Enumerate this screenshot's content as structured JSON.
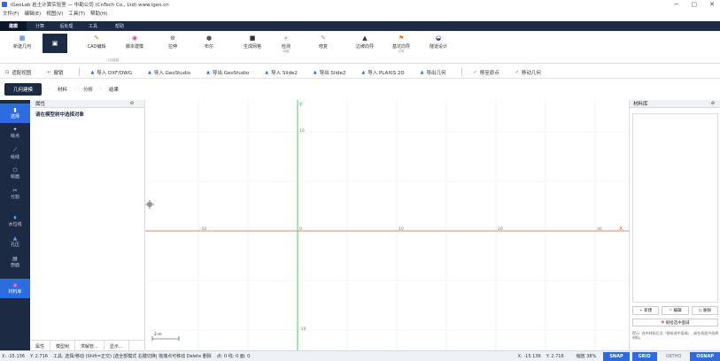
{
  "app": {
    "title": "iGeoLab 岩土计算实验室 — 中勘公司 (CnTech Co., Ltd)   www.igeo.cn"
  },
  "window_controls": {
    "minimize": "−",
    "maximize": "▢",
    "close": "✕"
  },
  "menu": [
    "文件(F)",
    "编辑(E)",
    "视图(V)",
    "工具(T)",
    "帮助(H)"
  ],
  "ribbon_tabs": [
    "建模",
    "计算",
    "后处理",
    "工具",
    "帮助"
  ],
  "ribbon": {
    "new_geometry": "新建几何",
    "cad_edit": "CAD编辑",
    "script_model": "脚本建模",
    "group_geometry": "几何建模",
    "extrude": "拉伸",
    "boolean": "布尔",
    "gen_mesh": "生成网格",
    "check": "检测",
    "group_mesh": "网格",
    "repair": "修复",
    "boundary_wizard": "边坡向导",
    "base_wizard": "基坑向导",
    "group_wizard": "向导",
    "tunnel_design": "隧道设计"
  },
  "toolbar2": {
    "fit_view": "适配视图",
    "undo": "撤销",
    "import_dxf": "导入 DXF/DWG",
    "import_geostudio": "导入 GeoStudio",
    "export_geostudio": "导出 GeoStudio",
    "import_slide2": "导入 Slide2",
    "export_slide2": "导出 Slide2",
    "import_plaxis": "导入 PLAXIS 2D",
    "export_geometry": "导出几何",
    "move_to_origin": "移至原点",
    "move_geometry": "移动几何"
  },
  "crumbs": [
    "几何建模",
    "材料",
    "分析",
    "结果"
  ],
  "leftbar": [
    {
      "label": "选择",
      "icon": "cursor-icon"
    },
    {
      "label": "绘点",
      "icon": "point-icon"
    },
    {
      "label": "绘线",
      "icon": "line-icon"
    },
    {
      "label": "绘面",
      "icon": "polygon-icon"
    },
    {
      "label": "分割",
      "icon": "split-icon"
    },
    {
      "label": "水位线",
      "icon": "water-icon"
    },
    {
      "label": "孔压",
      "icon": "pressure-icon"
    },
    {
      "label": "剖面",
      "icon": "section-icon"
    },
    {
      "label": "材料库",
      "icon": "library-icon"
    }
  ],
  "props": {
    "title": "属性",
    "hint": "请在模型树中选择对象",
    "tabs": [
      "属性",
      "模型树",
      "求解管...",
      "显示..."
    ]
  },
  "canvas": {
    "axis_x_label": "X",
    "axis_y_label": "Y",
    "x_ticks": [
      "-10",
      "0",
      "10",
      "20",
      "30"
    ],
    "y_ticks": [
      "10",
      "0",
      "-10"
    ],
    "scale_label": "2 m"
  },
  "matlib": {
    "title": "材料库",
    "new_btn": "新建",
    "edit_btn": "编辑",
    "delete_btn": "删除",
    "apply_btn": "赋给选中面域",
    "note": "提示: 选中材料后点「赋给选中面域」, 或在画面中选择材料。"
  },
  "status": {
    "left_x": "X: -15.136",
    "left_y": "Y: 2.716",
    "info": "工具: 选择/移动 (Shift=正交) |选全部模式 右键切换| 拖拽点可移动 Delete 删除",
    "counts": "点: 0  线: 0  面: 0",
    "right_x": "X: -15.136",
    "right_y": "Y: 2.716",
    "zoom": "缩放 38%",
    "snap": "SNAP",
    "grid": "GRID",
    "ortho": "ORTHO",
    "osnap": "OSNAP"
  },
  "colors": {
    "accent": "#2d6cdf",
    "navy": "#1d2a44",
    "x_axis": "#e05a3a",
    "y_axis": "#2bb54a",
    "grid": "#e8ebef"
  }
}
